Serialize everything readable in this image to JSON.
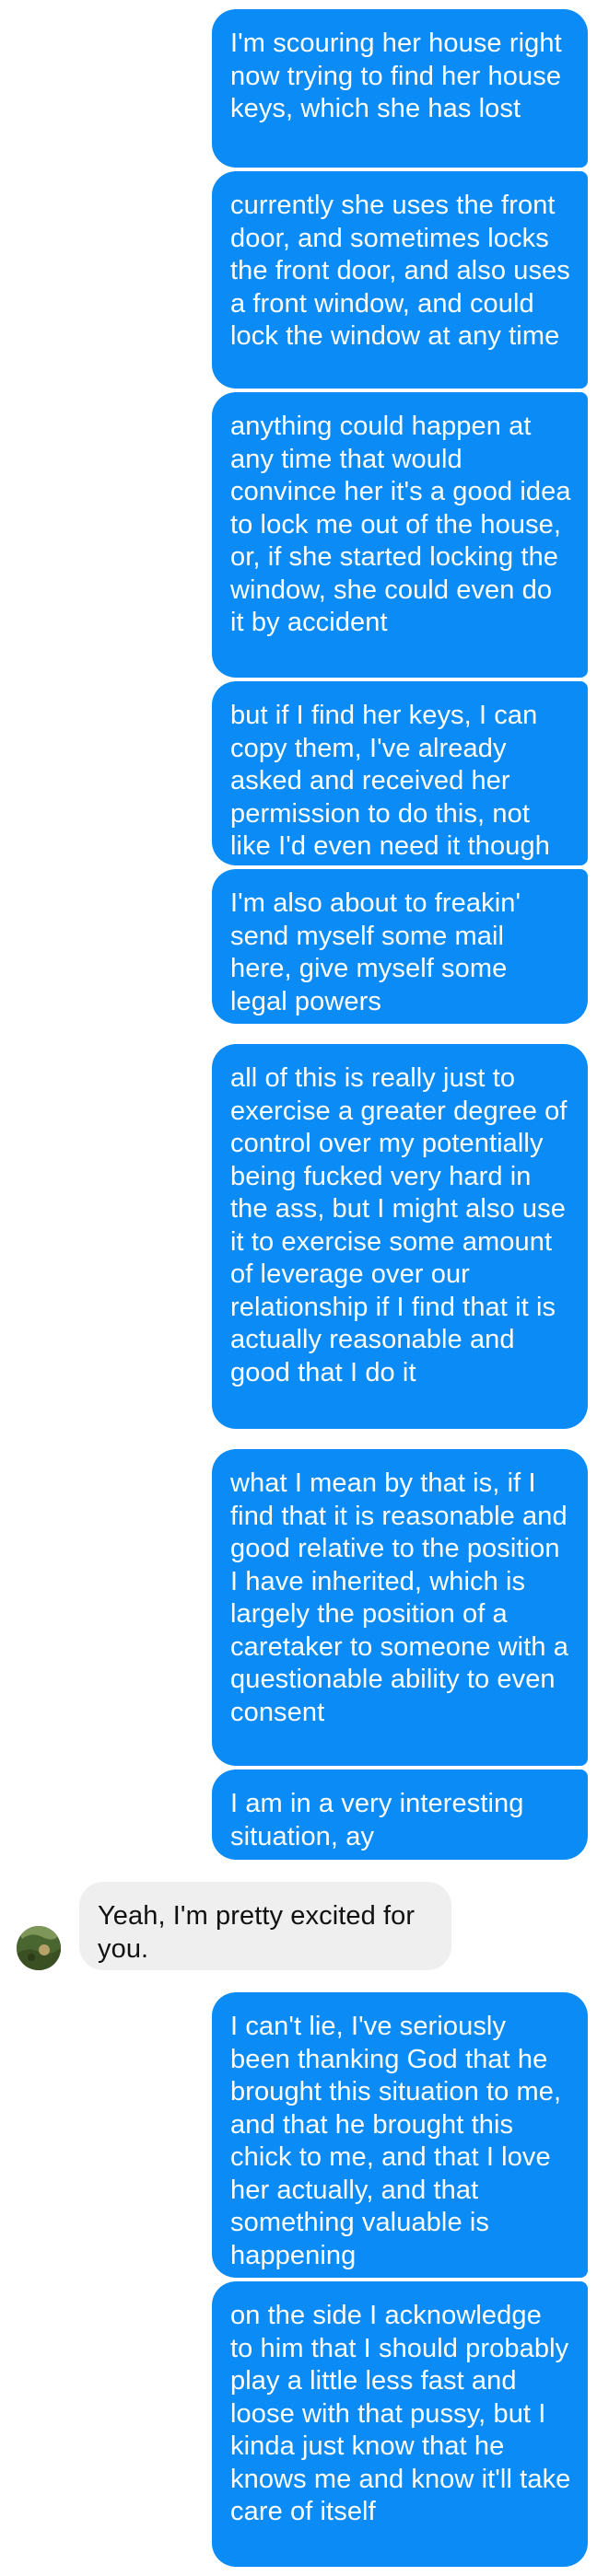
{
  "messages": [
    {
      "dir": "out",
      "text": "I'm scouring her house right now trying to find her house keys, which she has lost"
    },
    {
      "dir": "out",
      "text": "currently she uses the front door, and sometimes locks the front door, and also uses a front window, and could lock the window at any time"
    },
    {
      "dir": "out",
      "text": "anything could happen at any time that would convince her it's a good idea to lock me out of the house, or, if she started locking the window, she could even do it by accident"
    },
    {
      "dir": "out",
      "text": "but if I find her keys, I can copy them, I've already asked and received her permission to do this, not like I'd even need it though"
    },
    {
      "dir": "out",
      "text": "I'm also about to freakin' send myself some mail here, give myself some legal powers"
    },
    {
      "dir": "out",
      "text": "all of this is really just to exercise a greater degree of control over my potentially being fucked very hard in the ass, but I might also use it to exercise some amount of leverage over our relationship if I find that it is actually reasonable and good that I do it"
    },
    {
      "dir": "out",
      "text": "what I mean by that is, if I find that it is reasonable and good relative to the position I have inherited, which is largely the position of a caretaker to someone with a questionable ability to even consent"
    },
    {
      "dir": "out",
      "text": "I am in a very interesting situation, ay"
    },
    {
      "dir": "in",
      "text": "Yeah, I'm pretty excited for you."
    },
    {
      "dir": "out",
      "text": "I can't lie, I've seriously been thanking God that he brought this situation to me, and that he brought this chick to me, and that I love her actually, and that something valuable is happening"
    },
    {
      "dir": "out",
      "text": "on the side I acknowledge to him that I should probably play a little less fast and loose with that pussy, but I kinda just know that he knows me and know it'll take care of itself"
    }
  ],
  "colors": {
    "outgoing_bubble": "#0a8bf5",
    "incoming_bubble": "#efefef",
    "outgoing_text": "#ffffff",
    "incoming_text": "#111111"
  },
  "icons": {
    "avatar": "contact-avatar-photo"
  }
}
